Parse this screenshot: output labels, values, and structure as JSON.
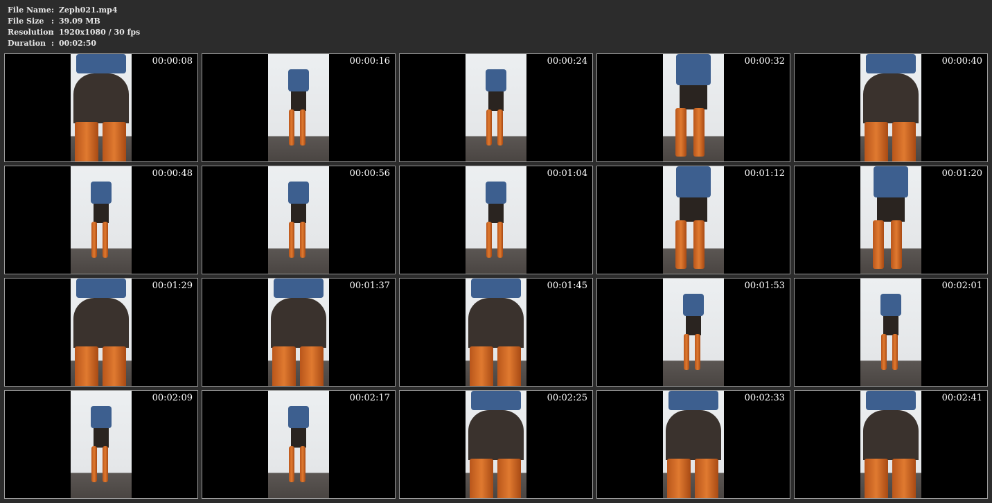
{
  "info": [
    {
      "label": "File Name",
      "value": "Zeph021.mp4"
    },
    {
      "label": "File Size",
      "value": "39.09 MB"
    },
    {
      "label": "Resolution",
      "value": "1920x1080 / 30 fps"
    },
    {
      "label": "Duration",
      "value": "00:02:50"
    }
  ],
  "separator": ":",
  "thumbnails": [
    {
      "timestamp": "00:00:08",
      "view": "close"
    },
    {
      "timestamp": "00:00:16",
      "view": "full"
    },
    {
      "timestamp": "00:00:24",
      "view": "full"
    },
    {
      "timestamp": "00:00:32",
      "view": "mid"
    },
    {
      "timestamp": "00:00:40",
      "view": "close"
    },
    {
      "timestamp": "00:00:48",
      "view": "full"
    },
    {
      "timestamp": "00:00:56",
      "view": "full"
    },
    {
      "timestamp": "00:01:04",
      "view": "full"
    },
    {
      "timestamp": "00:01:12",
      "view": "mid"
    },
    {
      "timestamp": "00:01:20",
      "view": "mid"
    },
    {
      "timestamp": "00:01:29",
      "view": "close"
    },
    {
      "timestamp": "00:01:37",
      "view": "close"
    },
    {
      "timestamp": "00:01:45",
      "view": "close"
    },
    {
      "timestamp": "00:01:53",
      "view": "full"
    },
    {
      "timestamp": "00:02:01",
      "view": "full"
    },
    {
      "timestamp": "00:02:09",
      "view": "full"
    },
    {
      "timestamp": "00:02:17",
      "view": "full"
    },
    {
      "timestamp": "00:02:25",
      "view": "close"
    },
    {
      "timestamp": "00:02:33",
      "view": "close"
    },
    {
      "timestamp": "00:02:41",
      "view": "close"
    }
  ]
}
